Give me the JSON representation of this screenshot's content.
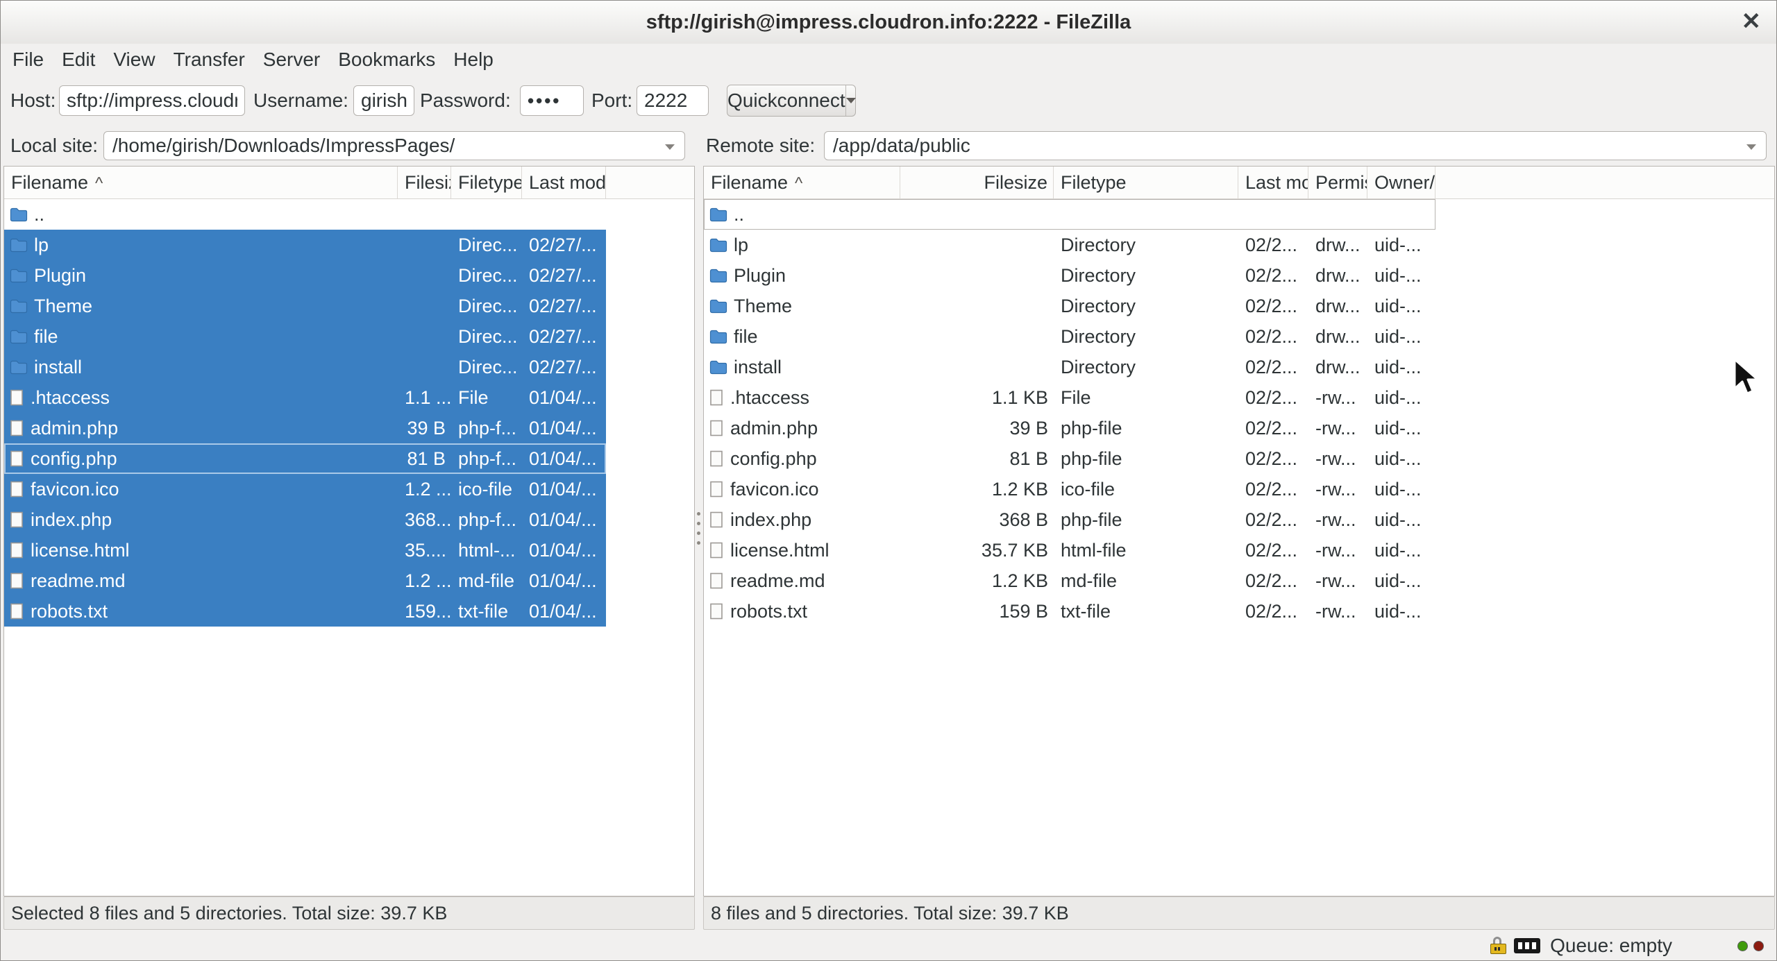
{
  "window": {
    "title": "sftp://girish@impress.cloudron.info:2222 - FileZilla",
    "close": "✕"
  },
  "menu": {
    "items": [
      "File",
      "Edit",
      "View",
      "Transfer",
      "Server",
      "Bookmarks",
      "Help"
    ]
  },
  "quickconnect": {
    "host_label": "Host:",
    "host_value": "sftp://impress.cloudron.info",
    "username_label": "Username:",
    "username_value": "girish",
    "password_label": "Password:",
    "password_value": "••••",
    "port_label": "Port:",
    "port_value": "2222",
    "button_label": "Quickconnect"
  },
  "local_pane": {
    "site_label": "Local site:",
    "site_value": "/home/girish/Downloads/ImpressPages/",
    "sort_indicator": "^",
    "columns": [
      "Filename",
      "Filesize",
      "Filetype",
      "Last modified"
    ],
    "rows": [
      {
        "name": "..",
        "icon": "folder",
        "size": "",
        "type": "",
        "modified": "",
        "selected": false,
        "focused": false
      },
      {
        "name": "lp",
        "icon": "folder",
        "size": "",
        "type": "Direc...",
        "modified": "02/27/...",
        "selected": true,
        "focused": false
      },
      {
        "name": "Plugin",
        "icon": "folder",
        "size": "",
        "type": "Direc...",
        "modified": "02/27/...",
        "selected": true,
        "focused": false
      },
      {
        "name": "Theme",
        "icon": "folder",
        "size": "",
        "type": "Direc...",
        "modified": "02/27/...",
        "selected": true,
        "focused": false
      },
      {
        "name": "file",
        "icon": "folder",
        "size": "",
        "type": "Direc...",
        "modified": "02/27/...",
        "selected": true,
        "focused": false
      },
      {
        "name": "install",
        "icon": "folder",
        "size": "",
        "type": "Direc...",
        "modified": "02/27/...",
        "selected": true,
        "focused": false
      },
      {
        "name": ".htaccess",
        "icon": "file",
        "size": "1.1 ...",
        "type": "File",
        "modified": "01/04/...",
        "selected": true,
        "focused": false
      },
      {
        "name": "admin.php",
        "icon": "file",
        "size": "39 B",
        "type": "php-f...",
        "modified": "01/04/...",
        "selected": true,
        "focused": false
      },
      {
        "name": "config.php",
        "icon": "file",
        "size": "81 B",
        "type": "php-f...",
        "modified": "01/04/...",
        "selected": true,
        "focused": true
      },
      {
        "name": "favicon.ico",
        "icon": "file",
        "size": "1.2 ...",
        "type": "ico-file",
        "modified": "01/04/...",
        "selected": true,
        "focused": false
      },
      {
        "name": "index.php",
        "icon": "file",
        "size": "368...",
        "type": "php-f...",
        "modified": "01/04/...",
        "selected": true,
        "focused": false
      },
      {
        "name": "license.html",
        "icon": "file",
        "size": "35....",
        "type": "html-...",
        "modified": "01/04/...",
        "selected": true,
        "focused": false
      },
      {
        "name": "readme.md",
        "icon": "file",
        "size": "1.2 ...",
        "type": "md-file",
        "modified": "01/04/...",
        "selected": true,
        "focused": false
      },
      {
        "name": "robots.txt",
        "icon": "file",
        "size": "159...",
        "type": "txt-file",
        "modified": "01/04/...",
        "selected": true,
        "focused": false
      }
    ],
    "status": "Selected 8 files and 5 directories. Total size: 39.7 KB"
  },
  "remote_pane": {
    "site_label": "Remote site:",
    "site_value": "/app/data/public",
    "sort_indicator": "^",
    "columns": [
      "Filename",
      "Filesize",
      "Filetype",
      "Last modified",
      "Permissions",
      "Owner/Group"
    ],
    "rows": [
      {
        "name": "..",
        "icon": "folder",
        "size": "",
        "type": "",
        "modified": "",
        "perms": "",
        "owner": "",
        "focused": true
      },
      {
        "name": "lp",
        "icon": "folder",
        "size": "",
        "type": "Directory",
        "modified": "02/2...",
        "perms": "drw...",
        "owner": "uid-...",
        "focused": false
      },
      {
        "name": "Plugin",
        "icon": "folder",
        "size": "",
        "type": "Directory",
        "modified": "02/2...",
        "perms": "drw...",
        "owner": "uid-...",
        "focused": false
      },
      {
        "name": "Theme",
        "icon": "folder",
        "size": "",
        "type": "Directory",
        "modified": "02/2...",
        "perms": "drw...",
        "owner": "uid-...",
        "focused": false
      },
      {
        "name": "file",
        "icon": "folder",
        "size": "",
        "type": "Directory",
        "modified": "02/2...",
        "perms": "drw...",
        "owner": "uid-...",
        "focused": false
      },
      {
        "name": "install",
        "icon": "folder",
        "size": "",
        "type": "Directory",
        "modified": "02/2...",
        "perms": "drw...",
        "owner": "uid-...",
        "focused": false
      },
      {
        "name": ".htaccess",
        "icon": "file",
        "size": "1.1 KB",
        "type": "File",
        "modified": "02/2...",
        "perms": "-rw...",
        "owner": "uid-...",
        "focused": false
      },
      {
        "name": "admin.php",
        "icon": "file",
        "size": "39 B",
        "type": "php-file",
        "modified": "02/2...",
        "perms": "-rw...",
        "owner": "uid-...",
        "focused": false
      },
      {
        "name": "config.php",
        "icon": "file",
        "size": "81 B",
        "type": "php-file",
        "modified": "02/2...",
        "perms": "-rw...",
        "owner": "uid-...",
        "focused": false
      },
      {
        "name": "favicon.ico",
        "icon": "file",
        "size": "1.2 KB",
        "type": "ico-file",
        "modified": "02/2...",
        "perms": "-rw...",
        "owner": "uid-...",
        "focused": false
      },
      {
        "name": "index.php",
        "icon": "file",
        "size": "368 B",
        "type": "php-file",
        "modified": "02/2...",
        "perms": "-rw...",
        "owner": "uid-...",
        "focused": false
      },
      {
        "name": "license.html",
        "icon": "file",
        "size": "35.7 KB",
        "type": "html-file",
        "modified": "02/2...",
        "perms": "-rw...",
        "owner": "uid-...",
        "focused": false
      },
      {
        "name": "readme.md",
        "icon": "file",
        "size": "1.2 KB",
        "type": "md-file",
        "modified": "02/2...",
        "perms": "-rw...",
        "owner": "uid-...",
        "focused": false
      },
      {
        "name": "robots.txt",
        "icon": "file",
        "size": "159 B",
        "type": "txt-file",
        "modified": "02/2...",
        "perms": "-rw...",
        "owner": "uid-...",
        "focused": false
      }
    ],
    "status": "8 files and 5 directories. Total size: 39.7 KB"
  },
  "statusbar": {
    "queue_label": "Queue: empty"
  },
  "colors": {
    "selection": "#3a7fc2",
    "led_green": "#3f9b0b",
    "led_red": "#8c1b10",
    "folder_icon": "#4e90d2"
  }
}
